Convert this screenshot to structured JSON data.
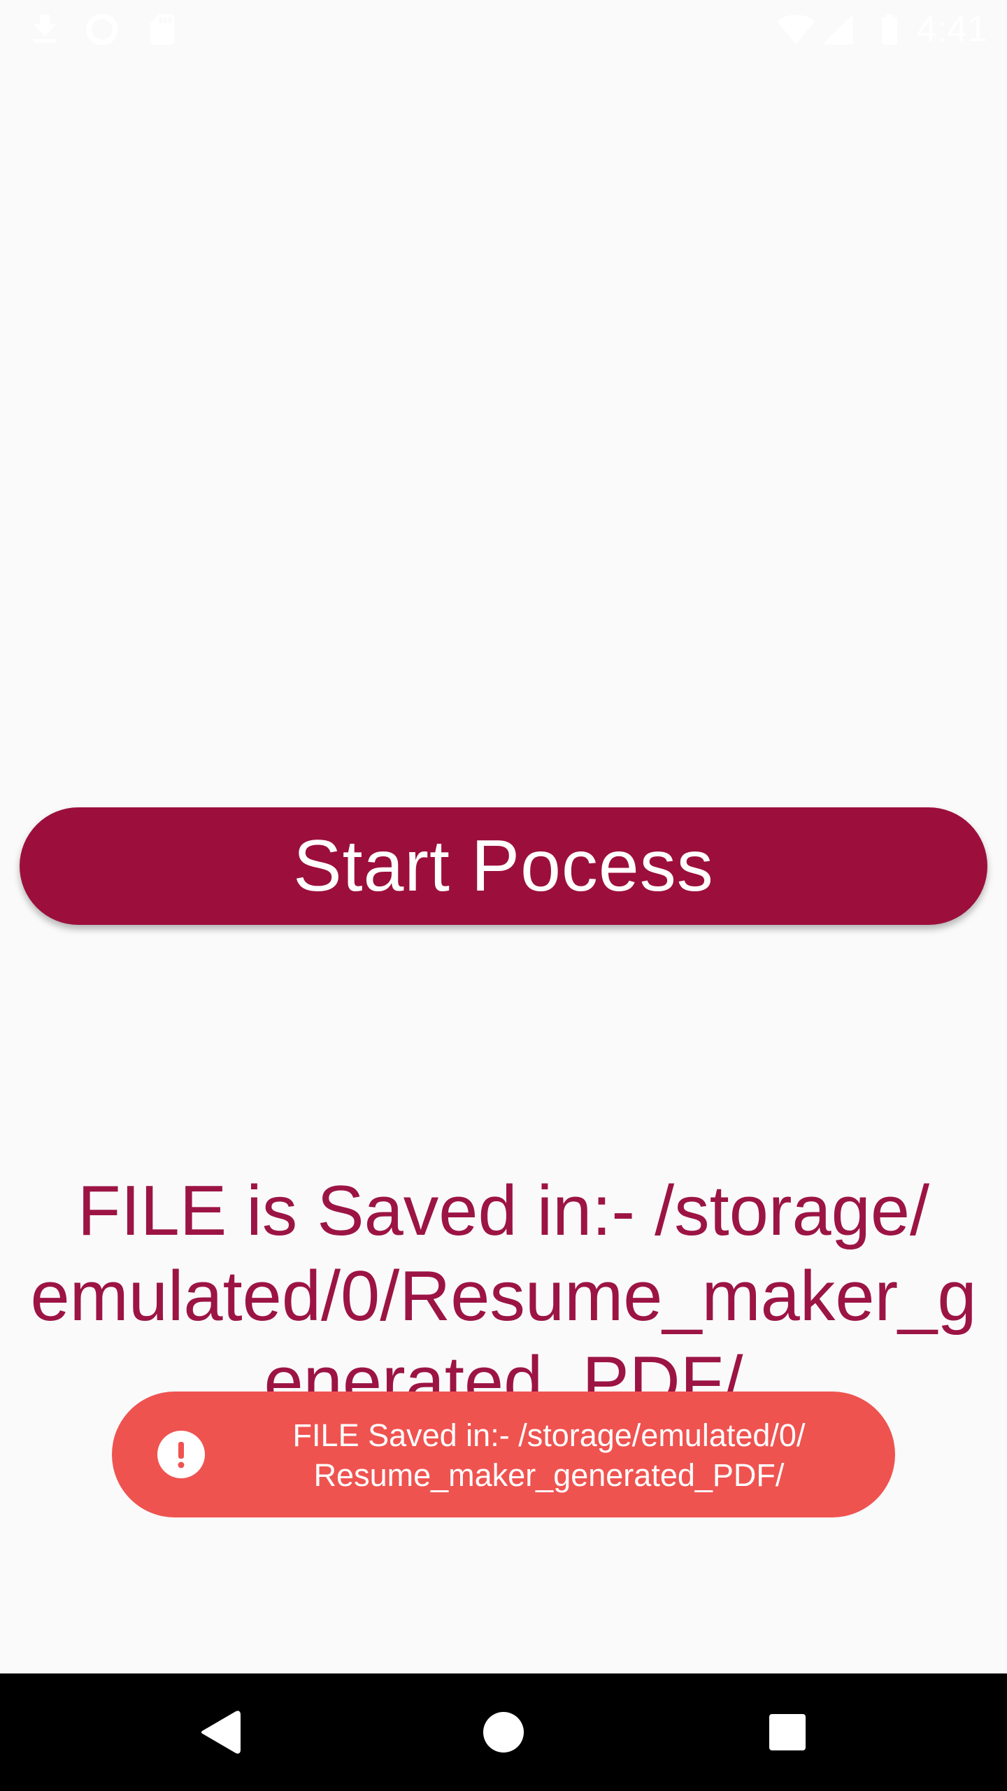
{
  "status_bar": {
    "time": "4:41",
    "left_icons": [
      "download-icon",
      "sync-icon",
      "sd-card-icon"
    ],
    "right_icons": [
      "wifi-icon",
      "cell-signal-icon",
      "battery-icon"
    ]
  },
  "main": {
    "start_button_label": "Start Pocess",
    "saved_message_lines": [
      "FILE is Saved in:- /storage/",
      "emulated/0/Resume_maker_g",
      "enerated_PDF/"
    ]
  },
  "toast": {
    "icon": "alert-icon",
    "lines": [
      "FILE Saved in:- /storage/emulated/0/",
      "Resume_maker_generated_PDF/"
    ]
  },
  "nav_bar": {
    "buttons": [
      "back-icon",
      "home-icon",
      "recents-icon"
    ]
  },
  "colors": {
    "background": "#fafafa",
    "primary": "#9c0f3c",
    "message_text": "#9c1444",
    "toast_background": "#ef5350",
    "nav_background": "#000000"
  }
}
